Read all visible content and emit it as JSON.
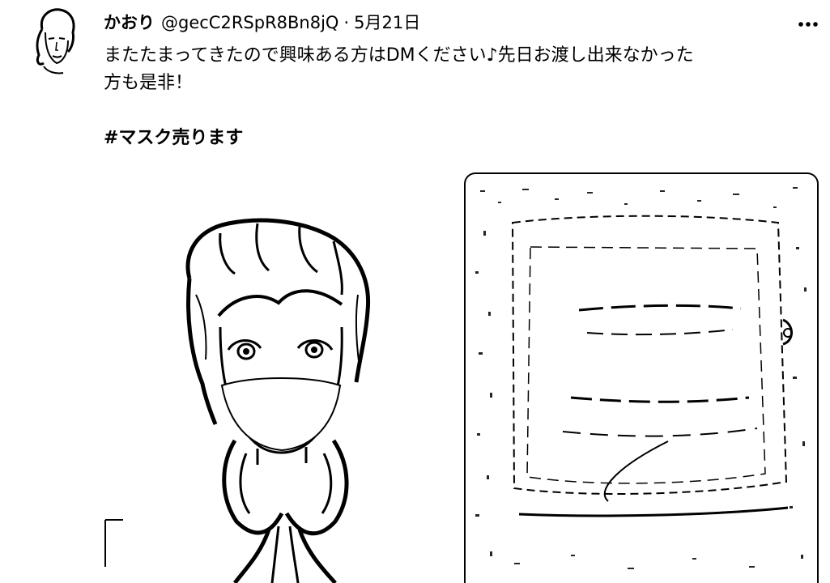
{
  "tweet": {
    "display_name": "かおり",
    "handle": "@gecC2RSpR8Bn8jQ",
    "separator": "·",
    "date": "5月21日",
    "text_line1": "またたまってきたので興味ある方はDMください♪先日お渡し出来なかった",
    "text_line2": "方も是非！",
    "hashtag": "#マスク売ります"
  },
  "icons": {
    "more": "more-horizontal-icon",
    "avatar": "avatar-sketch"
  },
  "colors": {
    "ink": "#000000",
    "background": "#ffffff"
  }
}
